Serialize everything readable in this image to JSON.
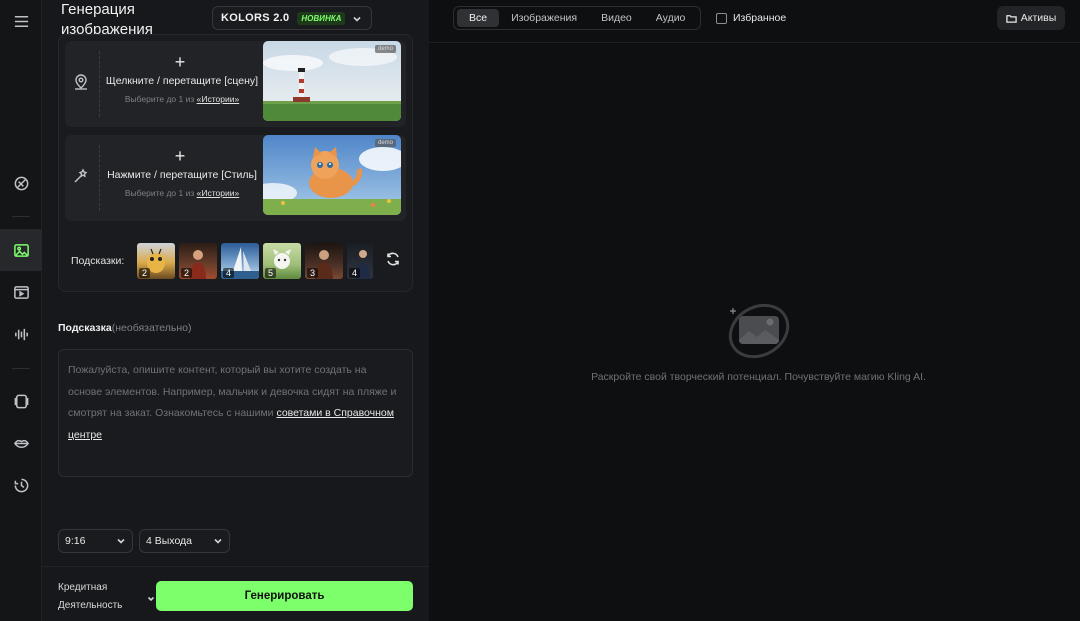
{
  "header": {
    "title_line1": "Генерация",
    "title_line2": "изображения",
    "model_name": "KOLORS 2.0",
    "model_badge": "НОВИНКА"
  },
  "uploads": [
    {
      "icon": "map-pin-icon",
      "main": "Щелкните / перетащите [сцену]",
      "sub_prefix": "Выберите до 1 из ",
      "sub_link": "«Истории»",
      "demo": "demo"
    },
    {
      "icon": "magic-wand-icon",
      "main": "Нажмите / перетащите [Стиль]",
      "sub_prefix": "Выберите до 1 из ",
      "sub_link": "«Истории»",
      "demo": "demo"
    }
  ],
  "hints": {
    "label": "Подсказки:",
    "items": [
      {
        "count": "2",
        "color": "#d9a94a"
      },
      {
        "count": "2",
        "color": "#5a3a2a"
      },
      {
        "count": "4",
        "color": "#3f6ea8"
      },
      {
        "count": "5",
        "color": "#9fbf7a"
      },
      {
        "count": "3",
        "color": "#4a3026"
      },
      {
        "count": "4",
        "color": "#2e3440"
      }
    ]
  },
  "prompt": {
    "label": "Подсказка",
    "optional": "(необязательно)",
    "placeholder": "Пожалуйста, опишите контент, который вы хотите создать на основе элементов. Например, мальчик и девочка сидят на пляже и смотрят на закат. Ознакомьтесь с нашими ",
    "link": "советами в Справочном центре"
  },
  "options": {
    "ratio": "9:16",
    "outputs": "4 Выхода"
  },
  "footer": {
    "credits_line1": "Кредитная",
    "credits_line2": "Деятельность",
    "generate": "Генерировать"
  },
  "right": {
    "tabs": [
      "Все",
      "Изображения",
      "Видео",
      "Аудио"
    ],
    "favorites": "Избранное",
    "assets": "Активы",
    "empty": "Раскройте свой творческий потенциал. Почувствуйте магию Kling AI."
  },
  "colors": {
    "accent": "#7cff6b"
  }
}
